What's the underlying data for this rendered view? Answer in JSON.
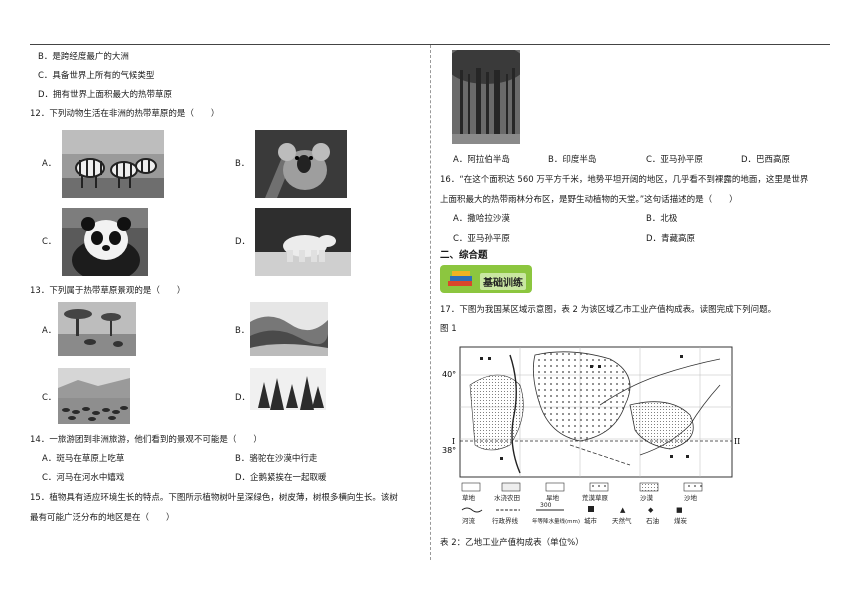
{
  "left": {
    "q11_options": [
      "B．是跨经度最广的大洲",
      "C．具备世界上所有的气候类型",
      "D．拥有世界上面积最大的热带草原"
    ],
    "q12": {
      "stem": "12．下列动物生活在非洲的热带草原的是（　　）",
      "labels": [
        "A．",
        "B．",
        "C．",
        "D．"
      ]
    },
    "q13": {
      "stem": "13．下列属于热带草原景观的是（　　）",
      "labels": [
        "A．",
        "B．",
        "C．",
        "D．"
      ]
    },
    "q14": {
      "stem": "14．一旅游团到非洲旅游，他们看到的景观不可能是（　　）",
      "options": [
        "A．斑马在草原上吃草",
        "B．骆驼在沙漠中行走",
        "C．河马在河水中嬉戏",
        "D．企鹅紧挨在一起取暖"
      ]
    },
    "q15": {
      "line1": "15．植物具有适应环境生长的特点。下图所示植物树叶呈深绿色，树皮薄，树根多横向生长。该树",
      "line2": "最有可能广泛分布的地区是在（　　）"
    }
  },
  "right": {
    "q15_options": [
      "A．阿拉伯半岛",
      "B．印度半岛",
      "C．亚马孙平原",
      "D．巴西高原"
    ],
    "q16": {
      "line1": "16．“在这个面积达 560 万平方千米，地势平坦开阔的地区，几乎看不到裸露的地面，这里是世界",
      "line2": "上面积最大的热带雨林分布区，是野生动植物的天堂。”这句话描述的是（　　）",
      "options": [
        "A．撒哈拉沙漠",
        "B．北极",
        "C．亚马孙平原",
        "D．青藏高原"
      ]
    },
    "section_title": "二、综合题",
    "badge_label": "基础训练",
    "q17": {
      "stem": "17．下图为我国某区域示意图，表 2 为该区域乙市工业产值构成表。读图完成下列问题。",
      "fig_label": "图 1",
      "table_caption": "表 2：乙地工业产值构成表（单位%）"
    },
    "map": {
      "lat_top": "40°",
      "lat_bottom": "38°",
      "roman_left": "I",
      "roman_right": "II",
      "legend_row1": [
        "草地",
        "水浇农田",
        "旱地",
        "荒漠草原",
        "沙漠",
        "沙地"
      ],
      "legend_row2": [
        "河流",
        "行政界线",
        "年等降水量线(mm)",
        "城市",
        "天然气",
        "石油",
        "煤炭"
      ],
      "isohyet_label": "300"
    }
  }
}
